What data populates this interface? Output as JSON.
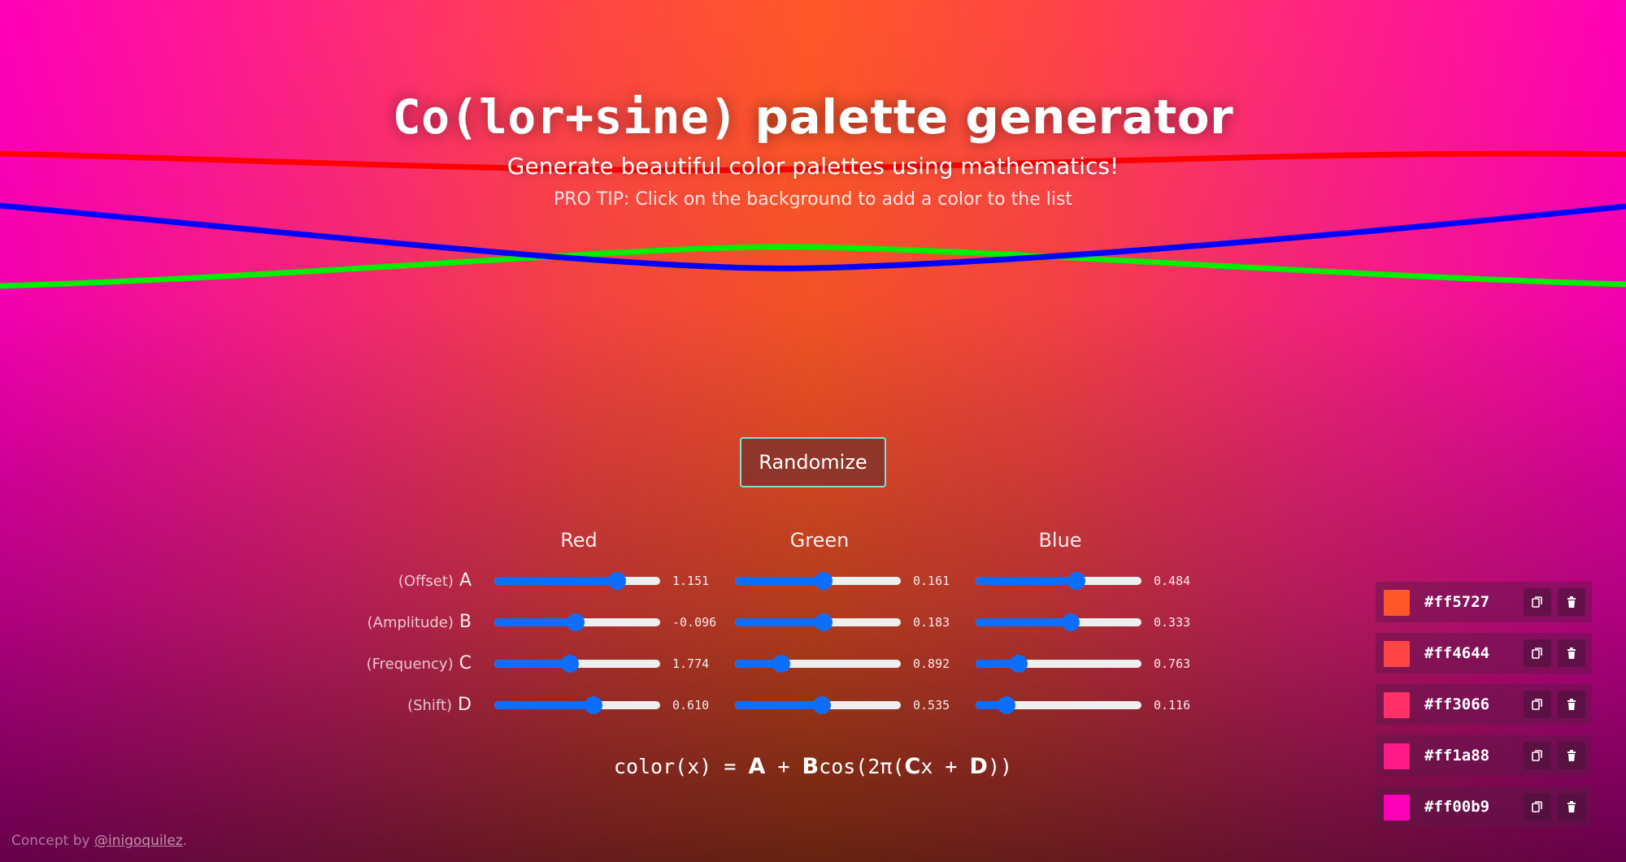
{
  "header": {
    "title_mono": "Co(lor+sine)",
    "title_rest": " palette generator",
    "subtitle": "Generate beautiful color palettes using mathematics!",
    "tip": "PRO TIP: Click on the background to add a color to the list"
  },
  "controls": {
    "randomize_label": "Randomize",
    "columns": [
      "Red",
      "Green",
      "Blue"
    ],
    "rows": [
      {
        "sub": "(Offset)",
        "letter": "A",
        "values": [
          "1.151",
          "0.161",
          "0.484"
        ]
      },
      {
        "sub": "(Amplitude)",
        "letter": "B",
        "values": [
          "-0.096",
          "0.183",
          "0.333"
        ]
      },
      {
        "sub": "(Frequency)",
        "letter": "C",
        "values": [
          "1.774",
          "0.892",
          "0.763"
        ]
      },
      {
        "sub": "(Shift)",
        "letter": "D",
        "values": [
          "0.610",
          "0.535",
          "0.116"
        ]
      }
    ],
    "slider_levels": [
      [
        0.77,
        0.54,
        0.62
      ],
      [
        0.49,
        0.54,
        0.58
      ],
      [
        0.45,
        0.25,
        0.23
      ],
      [
        0.61,
        0.53,
        0.15
      ]
    ]
  },
  "formula": {
    "prefix": "color(x) = ",
    "A": "A",
    "plus1": " + ",
    "B": "B",
    "cos": "cos(2π(",
    "C": "C",
    "x": "x + ",
    "D": "D",
    "suffix": "))"
  },
  "palette": [
    {
      "hex": "#ff5727"
    },
    {
      "hex": "#ff4644"
    },
    {
      "hex": "#ff3066"
    },
    {
      "hex": "#ff1a88"
    },
    {
      "hex": "#ff00b9"
    }
  ],
  "footer": {
    "prefix": "Concept by ",
    "link": "@inigoquilez",
    "suffix": "."
  },
  "colors": {
    "red_curve": "#ff0000",
    "green_curve": "#00ff00",
    "blue_curve": "#0000ff",
    "slider_accent": "#0d6efd",
    "button_border": "#7fe0d6"
  },
  "icons": {
    "copy": "copy-icon",
    "delete": "trash-icon"
  }
}
